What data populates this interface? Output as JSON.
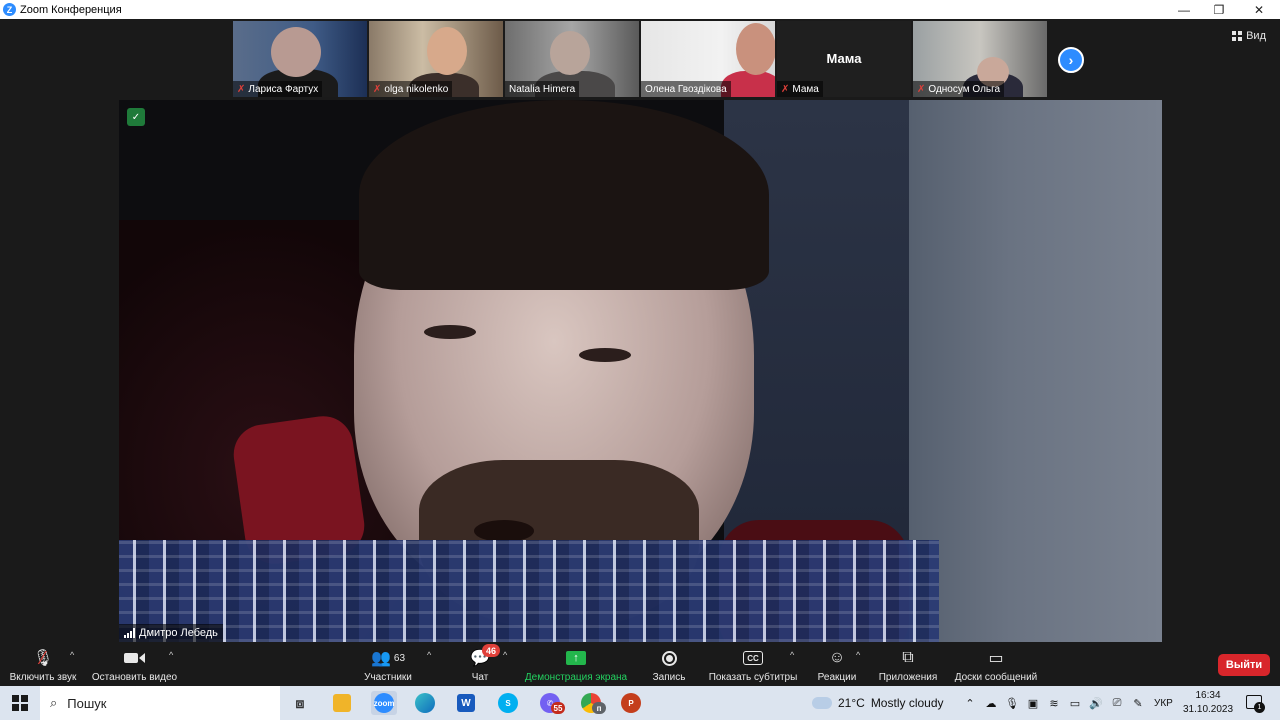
{
  "window": {
    "title": "Zoom Конференция",
    "minimize": "—",
    "restore": "❐",
    "close": "✕"
  },
  "view_button": "Вид",
  "thumbnails": [
    {
      "name": "Лариса Фартух",
      "muted": true
    },
    {
      "name": "olga nikolenko",
      "muted": true
    },
    {
      "name": "Natalia Himera",
      "muted": false
    },
    {
      "name": "Олена Гвоздікова",
      "muted": false
    },
    {
      "name": "Мама",
      "muted": true,
      "display_text": "Мама"
    },
    {
      "name": "Односум Ольга",
      "muted": true
    }
  ],
  "main_speaker": "Дмитро Лебедь",
  "controls": {
    "unmute": "Включить звук",
    "stop_video": "Остановить видео",
    "participants": "Участники",
    "participants_count": "63",
    "chat": "Чат",
    "chat_badge": "46",
    "share_screen": "Демонстрация экрана",
    "record": "Запись",
    "captions": "Показать субтитры",
    "captions_icon": "CC",
    "reactions": "Реакции",
    "apps": "Приложения",
    "whiteboards": "Доски сообщений",
    "leave": "Выйти"
  },
  "taskbar": {
    "search_placeholder": "Пошук",
    "zoom_app_label": "zoom",
    "viber_badge": "55",
    "chrome_badge": "п",
    "weather_temp": "21°C",
    "weather_desc": "Mostly cloudy",
    "language": "УКР",
    "time": "16:34",
    "date": "31.10.2023",
    "notifications_count": "1"
  },
  "colors": {
    "zoom_blue": "#2d8cff",
    "leave_red": "#d8262b",
    "share_green": "#23b64c",
    "mute_red": "#e0403a"
  }
}
